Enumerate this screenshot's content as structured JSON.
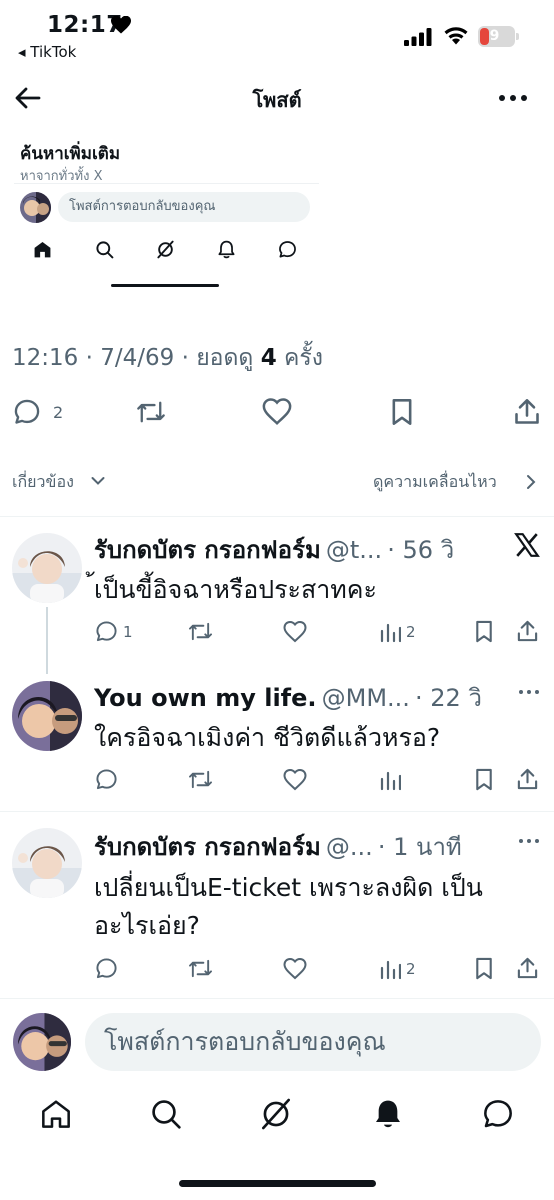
{
  "status_bar": {
    "time": "12:17",
    "back_app": "◂ TikTok",
    "battery_level": "9",
    "icons": [
      "heart-icon",
      "signal-icon",
      "wifi-icon",
      "battery-icon"
    ],
    "battery_color": "#e5463c"
  },
  "header": {
    "title": "โพสต์",
    "back_icon": "arrow-left-icon",
    "more_icon": "more-horizontal-icon"
  },
  "card": {
    "title": "ค้นหาเพิ่มเติม",
    "subtitle": "หาจากทั่วทั้ง X",
    "reply_placeholder": "โพสต์การตอบกลับของคุณ",
    "nav_icons": [
      "home-icon",
      "search-icon",
      "grok-icon",
      "bell-icon",
      "message-icon"
    ]
  },
  "post": {
    "time": "12:16",
    "date": "7/4/69",
    "views_prefix": "ยอดดู",
    "views_count": "4",
    "views_suffix": "ครั้ง",
    "sep": "·",
    "reply_count": "2",
    "actions": [
      "reply-icon",
      "repost-icon",
      "like-icon",
      "bookmark-icon",
      "share-icon"
    ]
  },
  "filters": {
    "related": "เกี่ยวข้อง",
    "activity": "ดูความเคลื่อนไหว"
  },
  "tweets": [
    {
      "name": "รับกดบัตร กรอกฟอร์ม",
      "handle": "@t...",
      "time": "· 56 วิ",
      "text": "้เป็นขี้อิจฉาหรือประสาทคะ",
      "replies": "1",
      "views": "2",
      "brand_icon": "x-logo-icon"
    },
    {
      "name": "You own my life.",
      "handle": "@MM...",
      "time": "· 22 วิ",
      "text": "ใครอิจฉาเมิงค่า ชีวิตดีแล้วหรอ?",
      "replies": "",
      "views": ""
    },
    {
      "name": "รับกดบัตร กรอกฟอร์ม",
      "handle": "@...",
      "time": "· 1 นาที",
      "text_line1": "เปลี่ยนเป็นE-ticket เพราะลงผิด เป็น",
      "text_line2": "อะไรเอ่ย?",
      "replies": "",
      "views": "2"
    }
  ],
  "bottom": {
    "reply_placeholder": "โพสต์การตอบกลับของคุณ",
    "nav_icons": [
      "home-icon",
      "search-icon",
      "grok-icon",
      "bell-icon",
      "message-icon"
    ]
  }
}
